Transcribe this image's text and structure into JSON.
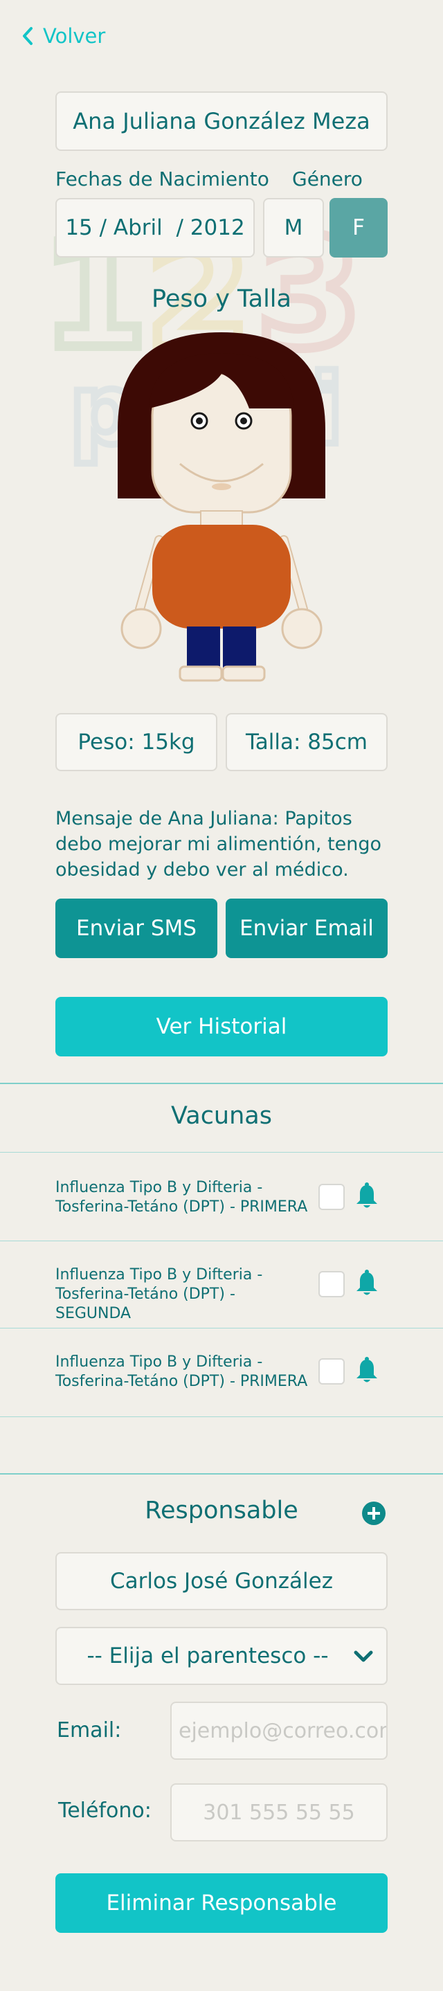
{
  "nav": {
    "back_label": "Volver"
  },
  "child": {
    "name": "Ana Juliana González Meza",
    "birth_label": "Fechas de Nacimiento",
    "gender_label": "Género",
    "birth_date": "15 / Abril  / 2012",
    "gender_m": "M",
    "gender_f": "F",
    "gender_selected": "F"
  },
  "body": {
    "title": "Peso y Talla",
    "weight": "Peso: 15kg",
    "height": "Talla: 85cm"
  },
  "message": {
    "text": "Mensaje de Ana Juliana: Papitos debo mejorar mi alimentión, tengo obesidad y debo ver al médico.",
    "sms_label": "Enviar SMS",
    "email_label": "Enviar Email",
    "history_label": "Ver Historial"
  },
  "vaccines": {
    "title": "Vacunas",
    "items": [
      {
        "line1": "Influenza Tipo B y Difteria -",
        "line2": "Tosferina-Tetáno (DPT) - PRIMERA",
        "checked": false
      },
      {
        "line1": "Influenza Tipo B y Difteria -",
        "line2": "Tosferina-Tetáno (DPT) - SEGUNDA",
        "checked": false
      },
      {
        "line1": "Influenza Tipo B y Difteria -",
        "line2": "Tosferina-Tetáno (DPT) - PRIMERA",
        "checked": false
      }
    ]
  },
  "responsible": {
    "title": "Responsable",
    "name": "Carlos José González",
    "relationship_placeholder": "-- Elija el parentesco --",
    "email_label": "Email:",
    "email_placeholder": "ejemplo@correo.com",
    "phone_label": "Teléfono:",
    "phone_placeholder": "301 555 55 55",
    "delete_label": "Eliminar Responsable"
  },
  "colors": {
    "primary_text": "#0f6f73",
    "button_dark": "#0e9494",
    "button_light": "#12c4c7",
    "gender_selected_bg": "#5aa6a4",
    "shirt": "#cc5a1c",
    "hair": "#3d0a05",
    "pants": "#0d1a6b"
  },
  "icons": {
    "back": "chevron-left-icon",
    "bell": "bell-icon",
    "add": "plus-circle-icon",
    "dropdown": "chevron-down-icon"
  }
}
